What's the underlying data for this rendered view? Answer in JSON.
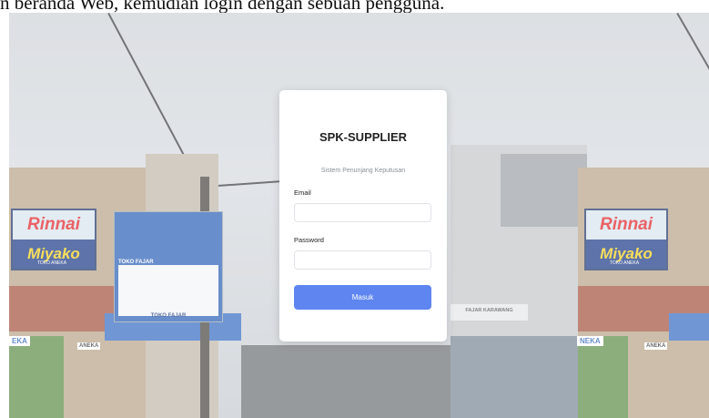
{
  "document": {
    "caption": "n beranda Web, kemudian login dengan sebuah pengguna."
  },
  "background": {
    "sign_brand_top": "Rinnai",
    "sign_brand_bottom": "Miyako",
    "sign_store_left": "TOKO ANEKA",
    "sign_store_right": "TOKO ANEKA",
    "store_fajar": "TOKO FAJAR",
    "store_fajar_2": "TOKO FAJAR",
    "store_karawang": "FAJAR KARAWANG",
    "awning_left": "EKA",
    "awning_left_2": "ANEKA",
    "awning_right": "NEKA",
    "awning_right_2": "ANEKA"
  },
  "login": {
    "title": "SPK-SUPPLIER",
    "subtitle": "Sistem Penunjang Keputusan",
    "email_label": "Email",
    "email_value": "",
    "password_label": "Password",
    "password_value": "",
    "submit_label": "Masuk"
  },
  "colors": {
    "accent": "#5f86f0",
    "card_bg": "#ffffff",
    "overlay": "#cfd4d9"
  }
}
